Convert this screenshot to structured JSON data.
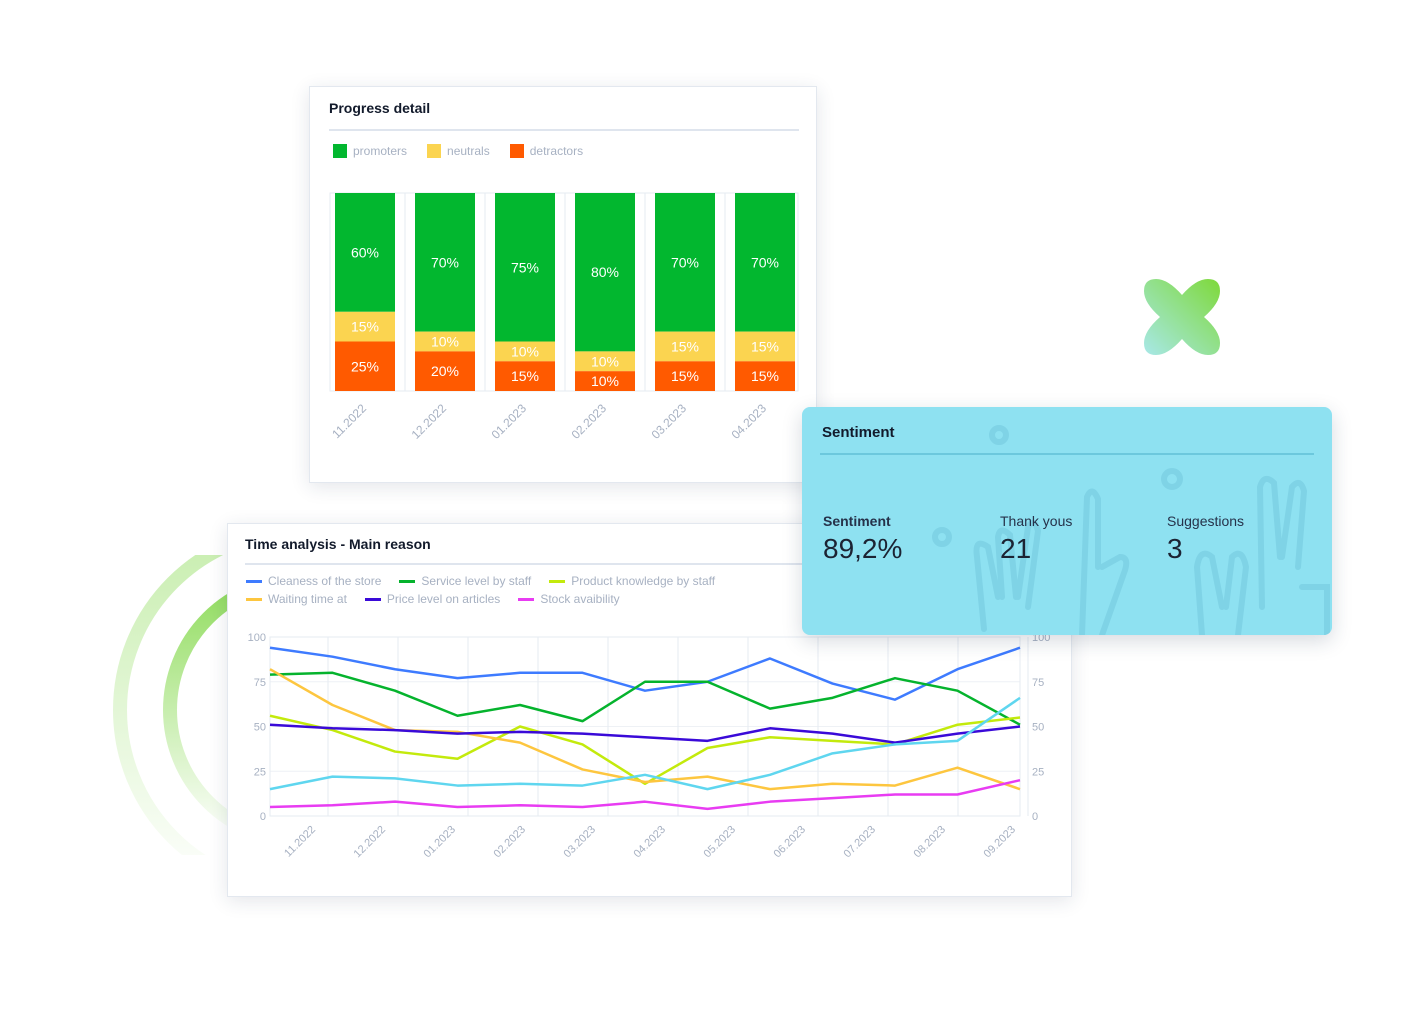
{
  "progress": {
    "title": "Progress detail",
    "chart_data": {
      "type": "bar",
      "stacked": true,
      "categories": [
        "11.2022",
        "12.2022",
        "01.2023",
        "02.2023",
        "03.2023",
        "04.2023"
      ],
      "series": [
        {
          "name": "promoters",
          "color": "#02b72f",
          "values": [
            60,
            70,
            75,
            80,
            70,
            70
          ]
        },
        {
          "name": "neutrals",
          "color": "#fbd450",
          "values": [
            15,
            10,
            10,
            10,
            15,
            15
          ]
        },
        {
          "name": "detractors",
          "color": "#ff5a00",
          "values": [
            25,
            20,
            15,
            10,
            15,
            15
          ]
        }
      ],
      "value_suffix": "%",
      "ylim": [
        0,
        100
      ],
      "legend": "top-left"
    }
  },
  "time": {
    "title": "Time analysis - Main reason",
    "chart_data": {
      "type": "line",
      "x_ticks": [
        "11.2022",
        "12.2022",
        "01.2023",
        "02.2023",
        "03.2023",
        "04.2023",
        "05.2023",
        "06.2023",
        "07.2023",
        "08.2023",
        "09.2023"
      ],
      "yticks": [
        0,
        25,
        50,
        75,
        100
      ],
      "ylim": [
        0,
        100
      ],
      "grid": true,
      "legend": "top-left",
      "series": [
        {
          "name": "Cleaness of the store",
          "color": "#3e7bff",
          "values": [
            94,
            89,
            82,
            77,
            80,
            80,
            70,
            75,
            88,
            74,
            65,
            82,
            94
          ]
        },
        {
          "name": "Service level by staff",
          "color": "#05b32d",
          "values": [
            79,
            80,
            70,
            56,
            62,
            53,
            75,
            75,
            60,
            66,
            77,
            70,
            51
          ]
        },
        {
          "name": "Product knowledge by staff",
          "color": "#c3ea0c",
          "values": [
            56,
            48,
            36,
            32,
            50,
            40,
            18,
            38,
            44,
            42,
            40,
            51,
            55
          ]
        },
        {
          "name": "Waiting time at",
          "color": "#fdc63f",
          "values": [
            82,
            62,
            48,
            47,
            41,
            26,
            19,
            22,
            15,
            18,
            17,
            27,
            15
          ]
        },
        {
          "name": "Price level on articles",
          "color": "#3a0ad8",
          "values": [
            51,
            49,
            48,
            46,
            47,
            46,
            44,
            42,
            49,
            46,
            41,
            46,
            50
          ]
        },
        {
          "name": "Stock avaibility",
          "color": "#e83cf2",
          "values": [
            5,
            6,
            8,
            5,
            6,
            5,
            8,
            4,
            8,
            10,
            12,
            12,
            20
          ]
        },
        {
          "color": "#5fd6ef",
          "values": [
            15,
            22,
            21,
            17,
            18,
            17,
            23,
            15,
            23,
            35,
            40,
            42,
            66
          ]
        }
      ]
    }
  },
  "sentiment": {
    "title": "Sentiment",
    "stats": [
      {
        "label": "Sentiment",
        "value": "89,2%"
      },
      {
        "label": "Thank yous",
        "value": "21"
      },
      {
        "label": "Suggestions",
        "value": "3"
      }
    ]
  },
  "colors": {
    "sentiment_bg": "#8ee1f1",
    "accent": "#7ed957"
  }
}
